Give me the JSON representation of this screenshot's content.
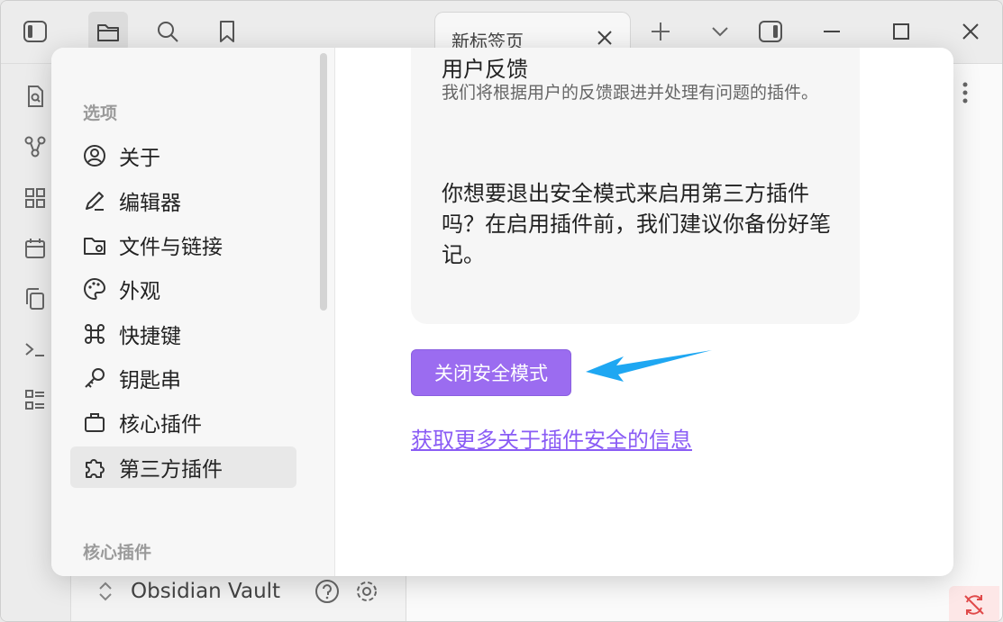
{
  "titlebar": {
    "tab_title": "新标签页"
  },
  "vault": {
    "name": "Obsidian Vault"
  },
  "settings": {
    "sections": [
      {
        "label": "选项"
      },
      {
        "label": "核心插件"
      }
    ],
    "nav_items": [
      {
        "label": "关于",
        "icon": "user-circle-icon"
      },
      {
        "label": "编辑器",
        "icon": "pencil-icon"
      },
      {
        "label": "文件与链接",
        "icon": "folder-cog-icon"
      },
      {
        "label": "外观",
        "icon": "palette-icon"
      },
      {
        "label": "快捷键",
        "icon": "command-icon"
      },
      {
        "label": "钥匙串",
        "icon": "key-icon"
      },
      {
        "label": "核心插件",
        "icon": "briefcase-icon"
      },
      {
        "label": "第三方插件",
        "icon": "puzzle-icon",
        "active": true
      }
    ]
  },
  "card": {
    "title": "用户反馈",
    "subtitle": "我们将根据用户的反馈跟进并处理有问题的插件。",
    "body": "你想要退出安全模式来启用第三方插件吗？在启用插件前，我们建议你备份好笔记。"
  },
  "actions": {
    "primary_label": "关闭安全模式",
    "link_label": "获取更多关于插件安全的信息"
  },
  "colors": {
    "accent": "#9b6cf0",
    "link": "#8a5cf5",
    "arrow": "#1ea7f2"
  }
}
